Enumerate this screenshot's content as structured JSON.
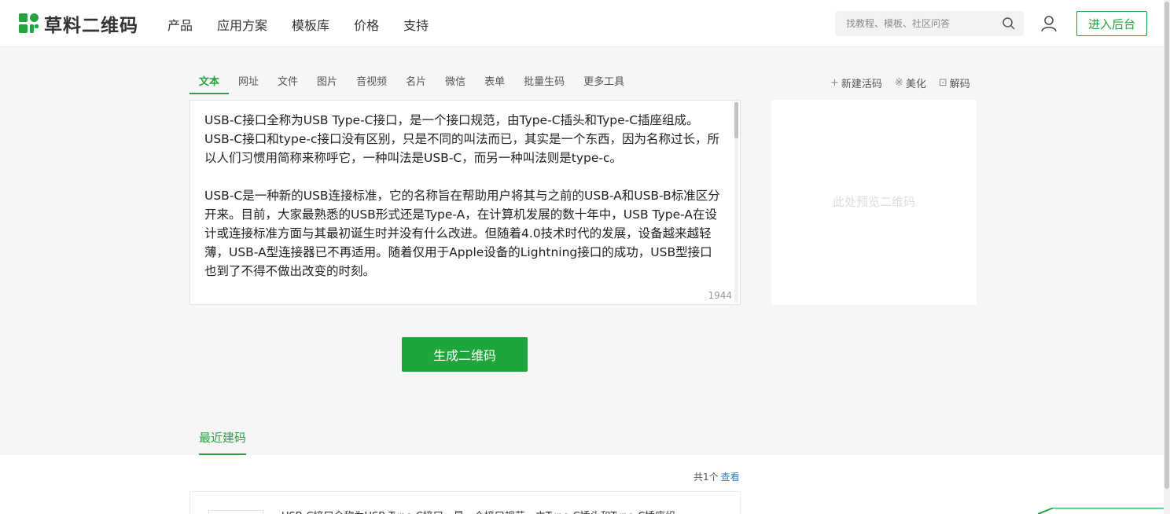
{
  "header": {
    "logo_text": "草料二维码",
    "nav": [
      "产品",
      "应用方案",
      "模板库",
      "价格",
      "支持"
    ],
    "search_placeholder": "找教程、模板、社区问答",
    "enter_label": "进入后台"
  },
  "tabs": [
    "文本",
    "网址",
    "文件",
    "图片",
    "音视频",
    "名片",
    "微信",
    "表单",
    "批量生码",
    "更多工具"
  ],
  "active_tab": "文本",
  "tools": [
    {
      "glyph": "+",
      "label": "新建活码"
    },
    {
      "glyph": "※",
      "label": "美化"
    },
    {
      "glyph": "⊡",
      "label": "解码"
    }
  ],
  "editor": {
    "text": "USB-C接口全称为USB Type-C接口，是一个接口规范，由Type-C插头和Type-C插座组成。USB-C接口和type-c接口没有区别，只是不同的叫法而已，其实是一个东西，因为名称过长，所以人们习惯用简称来称呼它，一种叫法是USB-C，而另一种叫法则是type-c。\n\nUSB-C是一种新的USB连接标准，它的名称旨在帮助用户将其与之前的USB-A和USB-B标准区分开来。目前，大家最熟悉的USB形式还是Type-A，在计算机发展的数十年中，USB Type-A在设计或连接标准方面与其最初诞生时并没有什么改进。但随着4.0技术时代的发展，设备越来越轻薄，USB-A型连接器已不再适用。随着仅用于Apple设备的Lightning接口的成功，USB型接口也到了不得不做出改变的时刻。",
    "char_count": "1944"
  },
  "preview": {
    "placeholder": "此处预览二维码"
  },
  "generate_label": "生成二维码",
  "recent": {
    "tab_label": "最近建码",
    "count_prefix": "共1个",
    "view_label": "查看",
    "item_snippet": "USB-C接口全称为USB Type-C接口，是一个接口规范，由Type-C插头和Type-C插座组"
  },
  "colors": {
    "brand": "#24a33f",
    "button": "#1ea53b",
    "link": "#2f7fc7"
  }
}
